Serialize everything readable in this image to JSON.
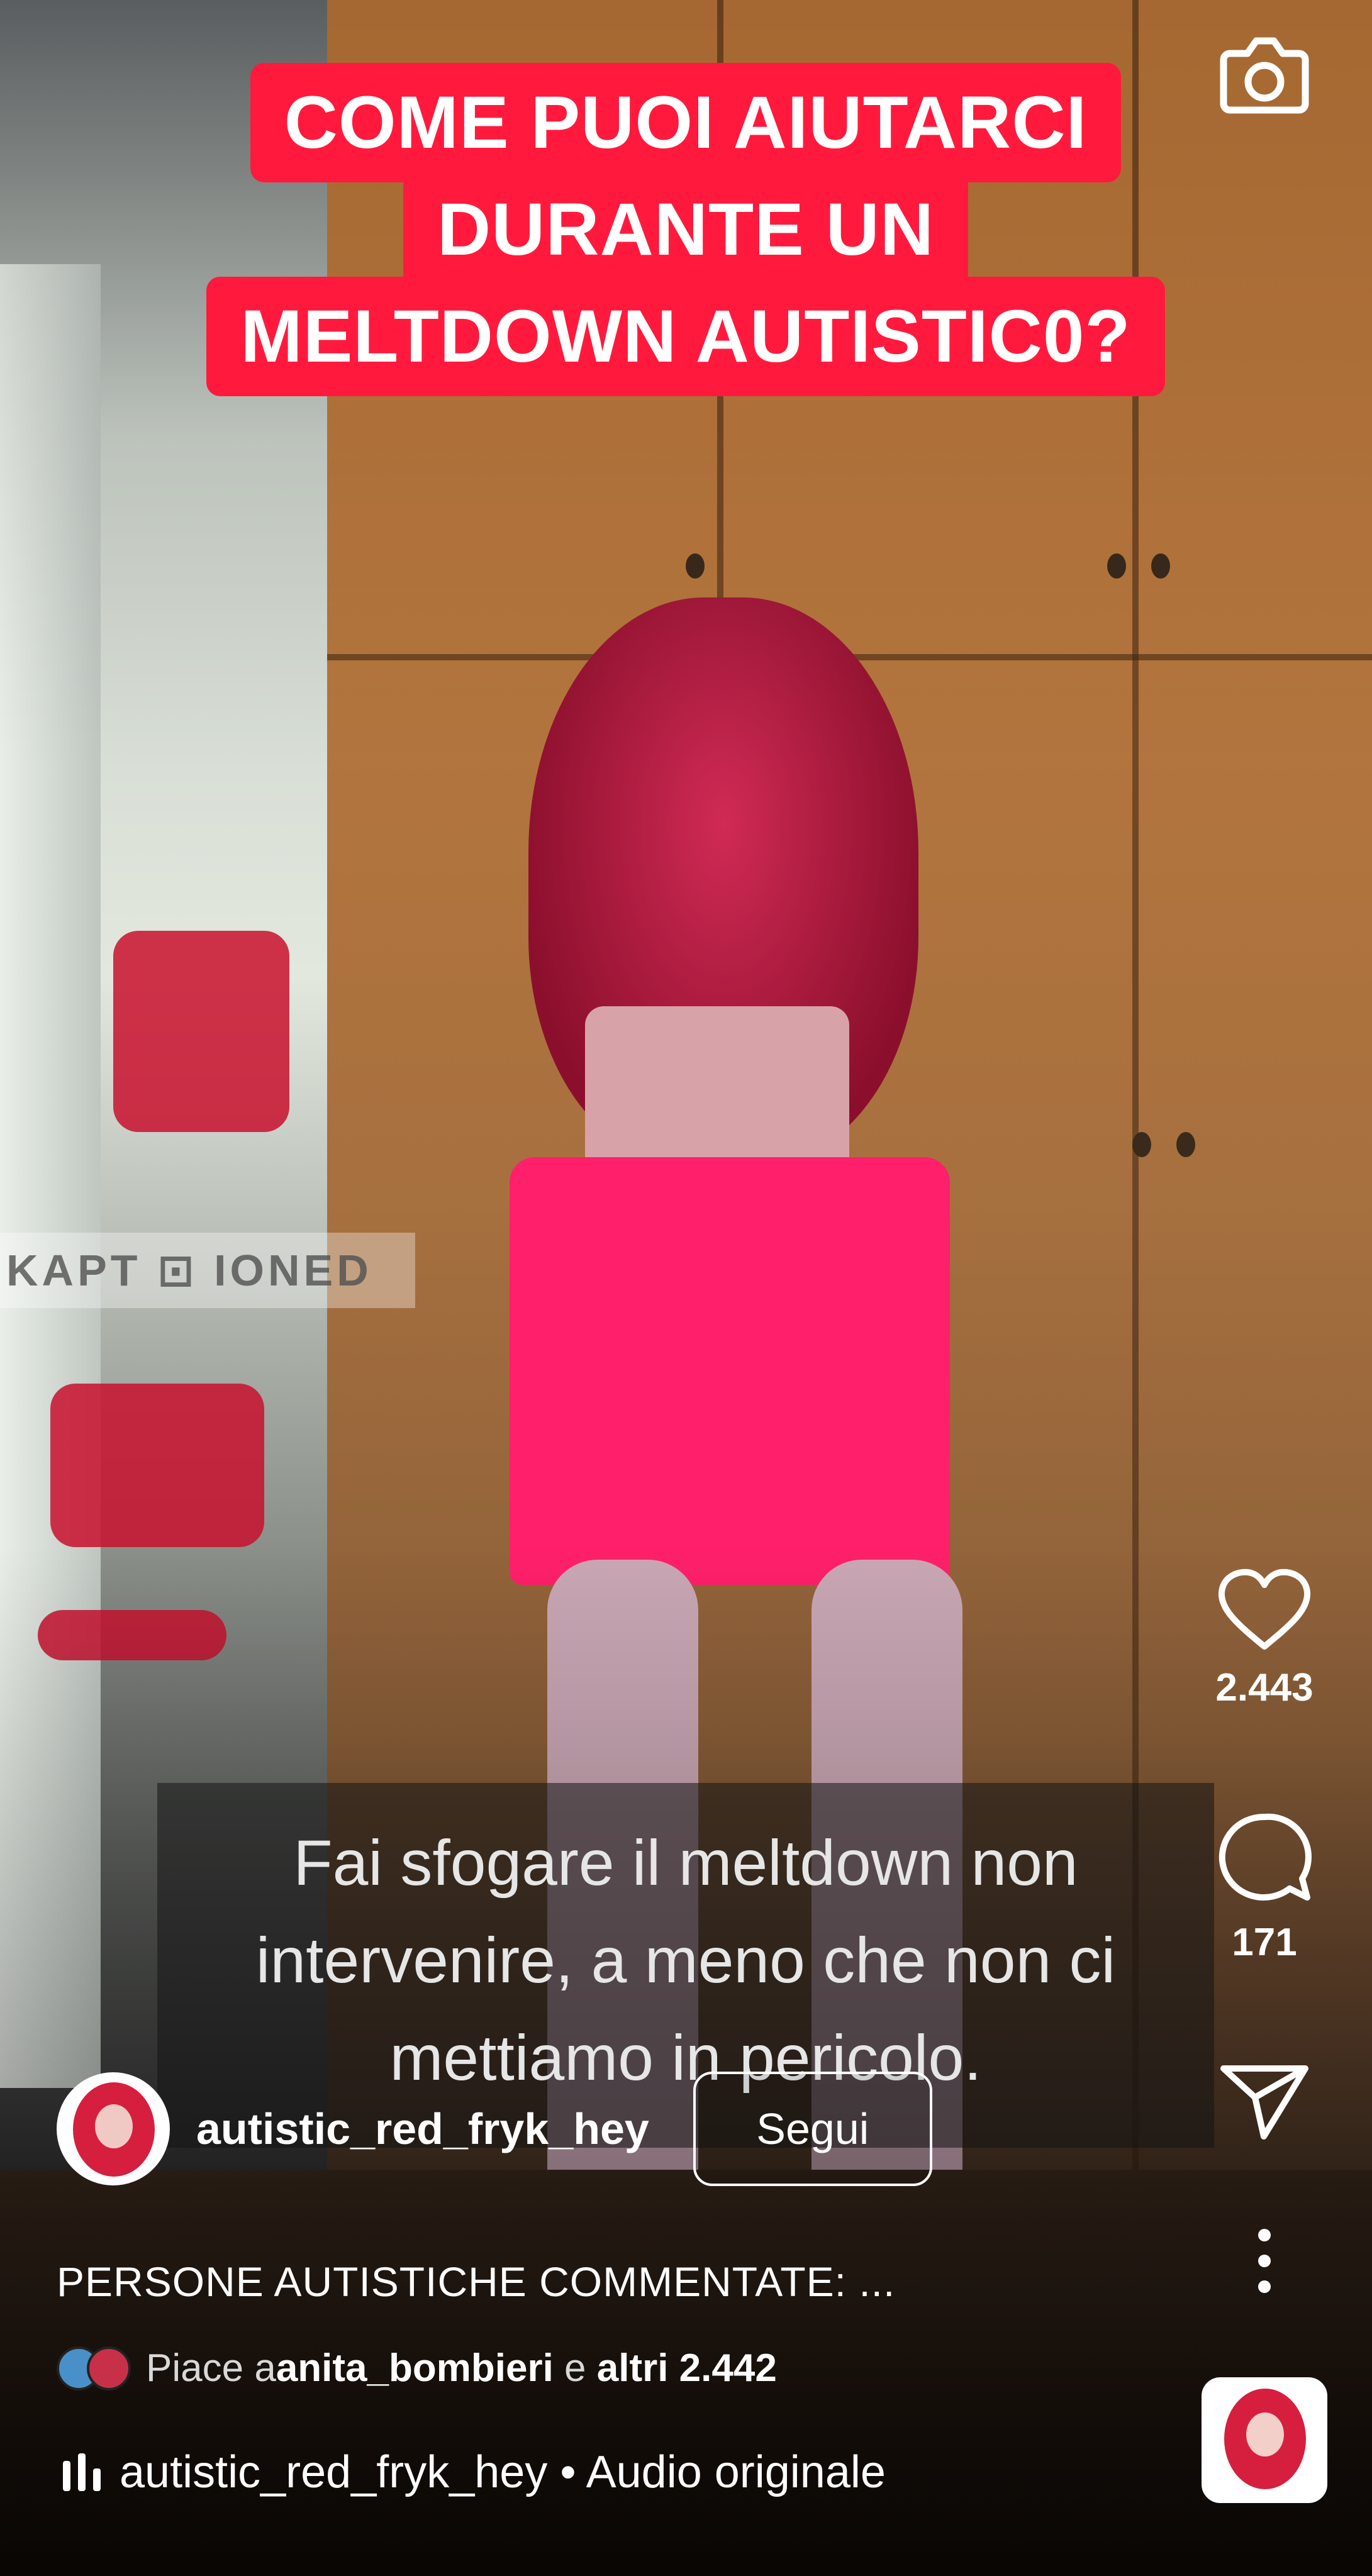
{
  "overlay": {
    "headline_lines": [
      "COME PUOI AIUTARCI",
      "DURANTE UN",
      "MELTDOWN AUTISTIC0?"
    ],
    "subtitle": "Fai sfogare il meltdown non intervenire, a meno che non ci mettiamo in pericolo.",
    "watermark": "KAPT ⊡ IONED"
  },
  "top": {
    "camera_icon": "camera-icon"
  },
  "actions": {
    "likes_count": "2.443",
    "comments_count": "171",
    "icons": [
      "heart-icon",
      "comment-icon",
      "send-icon",
      "more-vertical-icon"
    ]
  },
  "author": {
    "username": "autistic_red_fryk_hey",
    "follow_label": "Segui"
  },
  "caption": "PERSONE AUTISTICHE COMMENTATE: ...",
  "liked_by": {
    "prefix": "Piace a ",
    "user": "anita_bombieri",
    "middle": " e ",
    "others": "altri 2.442"
  },
  "audio": {
    "label": "autistic_red_fryk_hey • Audio originale"
  },
  "colors": {
    "headline_bg": "#ff1a3d",
    "text": "#ffffff"
  }
}
